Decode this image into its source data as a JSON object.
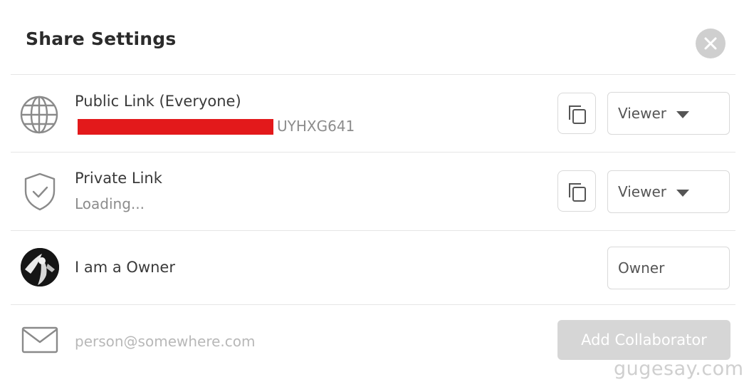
{
  "dialog": {
    "title": "Share Settings"
  },
  "public_link": {
    "title": "Public Link (Everyone)",
    "url_visible_suffix": "UYHXG641",
    "role": "Viewer"
  },
  "private_link": {
    "title": "Private Link",
    "status": "Loading...",
    "role": "Viewer"
  },
  "owner": {
    "name": "I am a Owner",
    "role": "Owner"
  },
  "collaborator": {
    "email_placeholder": "person@somewhere.com",
    "email_value": "",
    "add_label": "Add Collaborator"
  },
  "watermark": "gugesay.com",
  "icons": {
    "close": "close-icon",
    "public": "globe-icon",
    "private": "shield-check-icon",
    "copy": "copy-icon",
    "caret": "caret-down-icon",
    "email": "envelope-icon"
  },
  "colors": {
    "close_button": "#cfcfcf",
    "redaction": "#e3191b",
    "add_button_disabled": "#d6d6d6",
    "border": "#d9d9d9",
    "text_muted": "#8c8c8c"
  }
}
